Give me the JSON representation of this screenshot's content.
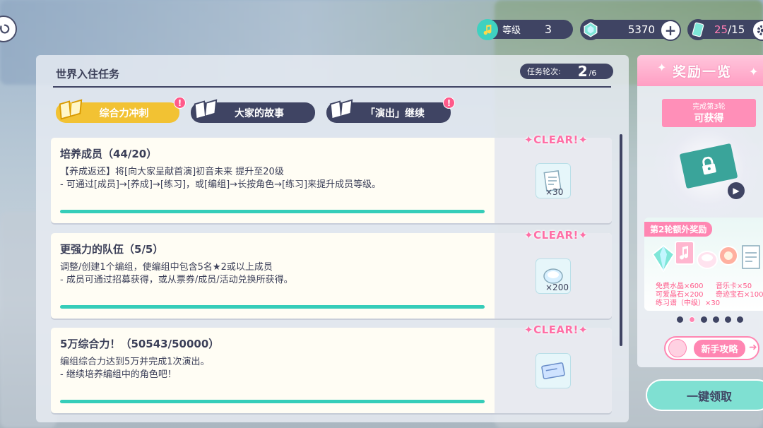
{
  "topbar": {
    "level_label": "等级",
    "level_value": "3",
    "crystal_value": "5370",
    "plus_label": "+",
    "ticket_current": "25",
    "ticket_max": "/15"
  },
  "panel": {
    "title": "世界入住任务",
    "round_label": "任务轮次:",
    "round_current": "2",
    "round_total": "/6"
  },
  "tabs": [
    {
      "label": "综合力冲刺",
      "alert": "!"
    },
    {
      "label": "大家的故事"
    },
    {
      "label": "「演出」继续",
      "alert": "!"
    }
  ],
  "missions": [
    {
      "name": "培养成员（44/20）",
      "desc": "【养成返还】将[向大家呈献首演]初音未来 提升至20级\n- 可通过[成员]→[养成]→[练习]，或[编组]→长按角色→[练习]来提升成员等级。",
      "clear": "✦CLEAR!✦",
      "reward_count": "×30",
      "progress": 1.0
    },
    {
      "name": "更强力的队伍（5/5）",
      "desc": "调整/创建1个编组，使编组中包含5名★2或以上成员\n- 成员可通过招募获得，或从票券/成员/活动兑换所获得。",
      "clear": "✦CLEAR!✦",
      "reward_count": "×200",
      "progress": 1.0
    },
    {
      "name": "5万综合力！（50543/50000）",
      "desc": "编组综合力达到5万并完成1次演出。\n- 继续培养编组中的角色吧！",
      "clear": "✦CLEAR!✦",
      "reward_count": "",
      "progress": 1.0
    }
  ],
  "rewards_panel": {
    "title": "奖励一览",
    "ribbon_small": "完成第3轮",
    "ribbon_big": "可获得",
    "bonus_title": "第2轮额外奖励",
    "bonus_items": [
      "免费水晶×600",
      "音乐卡×50",
      "可爱晶石×200",
      "奇迹宝石×100",
      "练习谱（中级）×30"
    ],
    "page_dots": 6,
    "active_dot": 1,
    "guide_label": "新手攻略",
    "claim_label": "一键领取"
  },
  "colors": {
    "accent_teal": "#36cdb9",
    "accent_pink": "#ff86b2",
    "dark_navy": "#3f4463",
    "tab_active": "#f2c233"
  }
}
